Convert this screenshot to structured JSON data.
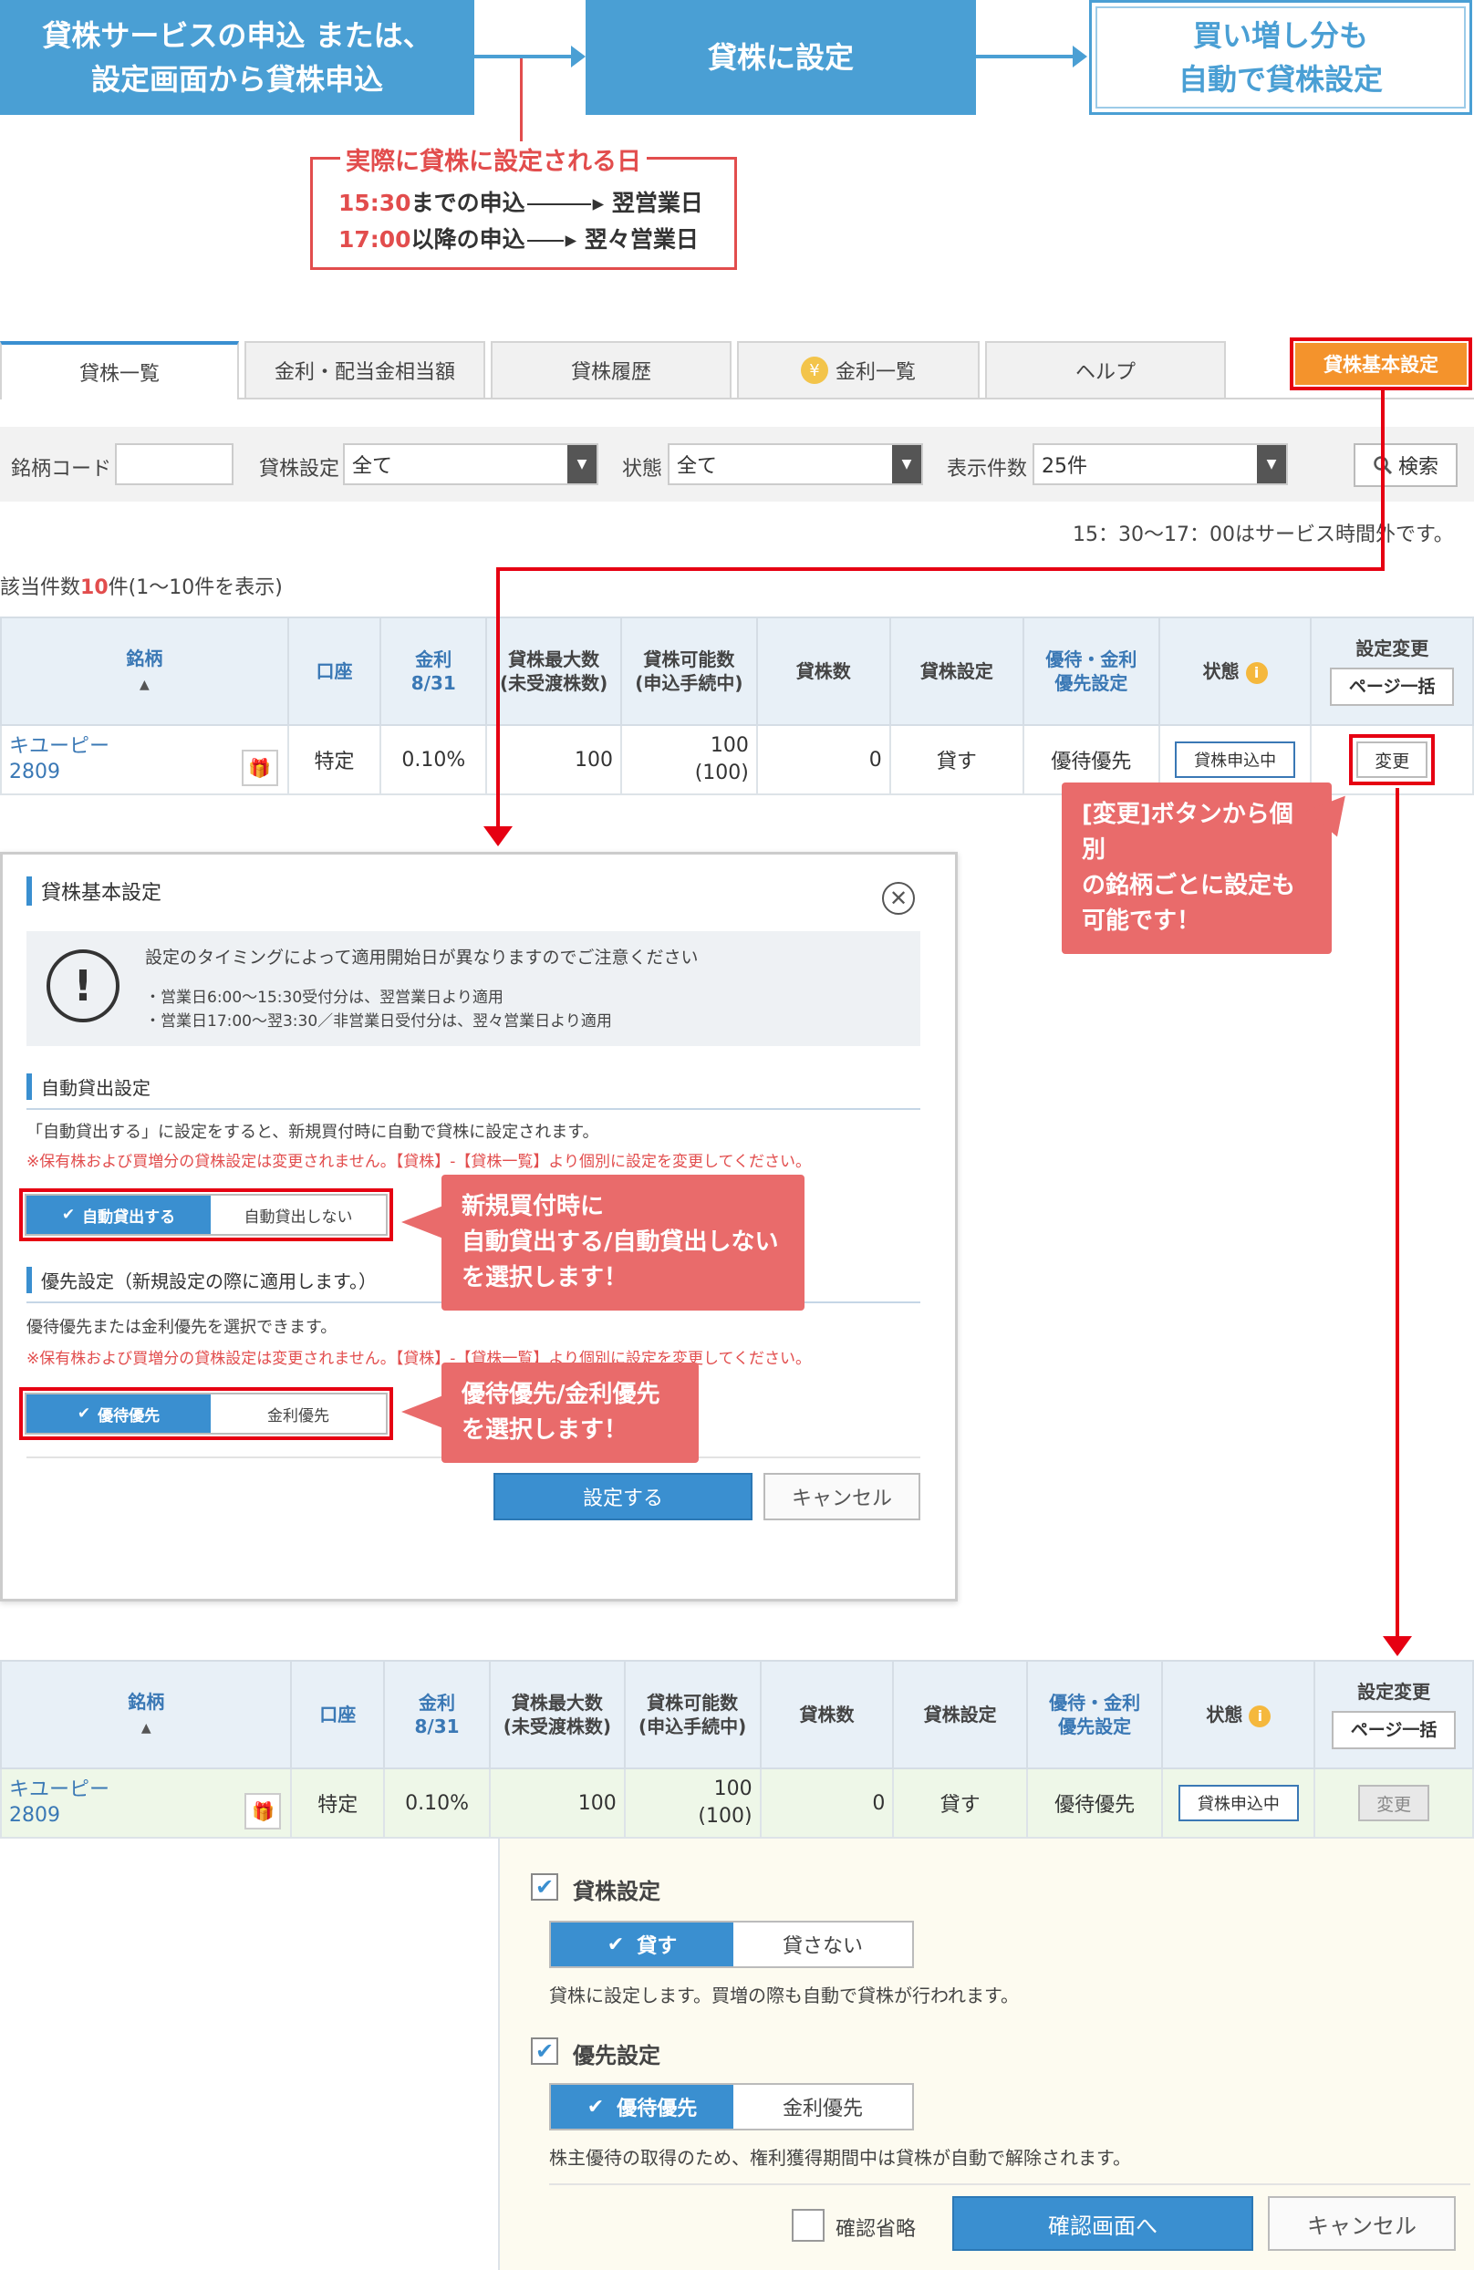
{
  "flow": {
    "step1": "貸株サービスの申込 または、\n設定画面から貸株申込",
    "step2": "貸株に設定",
    "step3": "買い増し分も\n自動で貸株設定",
    "timing_title": "実際に貸株に設定される日",
    "timing_rows": [
      {
        "time": "15:30",
        "text": "までの申込",
        "result": "翌営業日"
      },
      {
        "time": "17:00",
        "text": "以降の申込",
        "result": "翌々営業日"
      }
    ]
  },
  "tabs": [
    {
      "label": "貸株一覧"
    },
    {
      "label": "金利・配当金相当額"
    },
    {
      "label": "貸株履歴"
    },
    {
      "label": "金利一覧"
    },
    {
      "label": "ヘルプ"
    }
  ],
  "basic_setting_button": "貸株基本設定",
  "filters": {
    "code_label": "銘柄コード",
    "code_value": "",
    "setting_label": "貸株設定",
    "setting_value": "全て",
    "status_label": "状態",
    "status_value": "全て",
    "count_label": "表示件数",
    "count_value": "25件",
    "search_button": "検索"
  },
  "service_notice": "15：30〜17：00はサービス時間外です。",
  "result_count": {
    "prefix": "該当件数",
    "count": "10",
    "suffix": "件(1〜10件を表示)"
  },
  "table": {
    "headers": {
      "name": "銘柄",
      "account": "口座",
      "rate": "金利",
      "rate_date": "8/31",
      "max": "貸株最大数",
      "max_sub": "(未受渡株数)",
      "avail": "貸株可能数",
      "avail_sub": "(申込手続中)",
      "count": "貸株数",
      "setting": "貸株設定",
      "prio": "優待・金利",
      "prio_sub": "優先設定",
      "status": "状態",
      "change": "設定変更",
      "bulk_button": "ページ一括"
    },
    "row": {
      "name": "キユーピー",
      "code": "2809",
      "account": "特定",
      "rate": "0.10%",
      "max": "100",
      "avail": "100",
      "avail_sub": "(100)",
      "count": "0",
      "setting": "貸す",
      "prio": "優待優先",
      "status": "貸株申込中",
      "change_button": "変更"
    }
  },
  "callouts": {
    "change": "[変更]ボタンから個別\nの銘柄ごとに設定も\n可能です！",
    "auto": "新規買付時に\n自動貸出する/自動貸出しない\nを選択します！",
    "prio": "優待優先/金利優先\nを選択します！"
  },
  "modal": {
    "title": "貸株基本設定",
    "notice_main": "設定のタイミングによって適用開始日が異なりますのでご注意ください",
    "notice_sub1": "・営業日6:00〜15:30受付分は、翌営業日より適用",
    "notice_sub2": "・営業日17:00〜翌3:30／非営業日受付分は、翌々営業日より適用",
    "auto_heading": "自動貸出設定",
    "auto_desc": "「自動貸出する」に設定をすると、新規買付時に自動で貸株に設定されます。",
    "auto_warn": "※保有株および買増分の貸株設定は変更されません。【貸株】-【貸株一覧】より個別に設定を変更してください。",
    "auto_on": "自動貸出する",
    "auto_off": "自動貸出しない",
    "prio_heading": "優先設定（新規設定の際に適用します。）",
    "prio_desc": "優待優先または金利優先を選択できます。",
    "prio_warn": "※保有株および買増分の貸株設定は変更されません。【貸株】-【貸株一覧】より個別に設定を変更してください。",
    "prio_on": "優待優先",
    "prio_off": "金利優先",
    "submit": "設定する",
    "cancel": "キャンセル"
  },
  "detail": {
    "lend_heading": "貸株設定",
    "lend_on": "貸す",
    "lend_off": "貸さない",
    "lend_desc": "貸株に設定します。買増の際も自動で貸株が行われます。",
    "prio_heading": "優先設定",
    "prio_on": "優待優先",
    "prio_off": "金利優先",
    "prio_desc": "株主優待の取得のため、権利獲得期間中は貸株が自動で解除されます。",
    "skip_confirm": "確認省略",
    "confirm_button": "確認画面へ",
    "cancel_button": "キャンセル"
  },
  "colors": {
    "accent": "#3a8fd0",
    "orange": "#f4932c",
    "highlight": "#e60012",
    "callout": "#e96b6b"
  }
}
